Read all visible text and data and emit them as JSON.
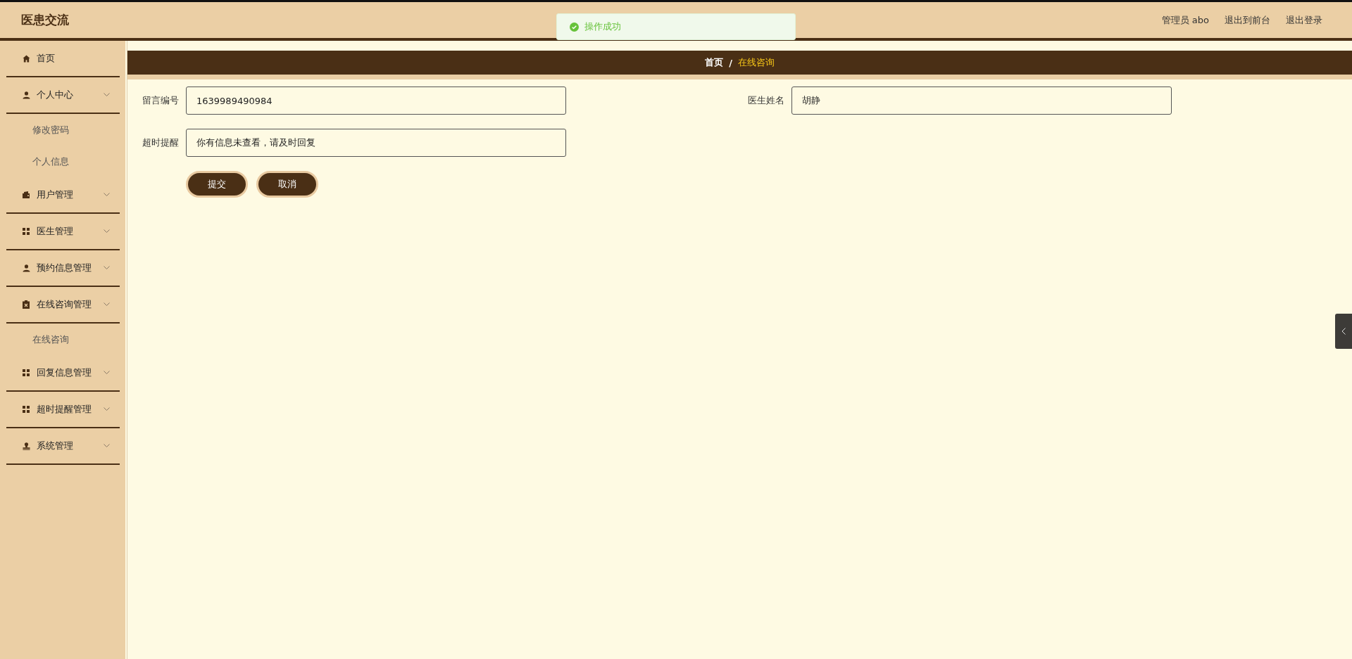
{
  "header": {
    "title": "医患交流",
    "links": [
      {
        "label": "管理员 abo"
      },
      {
        "label": "退出到前台"
      },
      {
        "label": "退出登录"
      }
    ]
  },
  "toast": {
    "kind": "success",
    "message": "操作成功"
  },
  "sidebar": {
    "items": [
      {
        "label": "首页",
        "kind": "link"
      },
      {
        "label": "个人中心",
        "kind": "menu",
        "children": [
          {
            "label": "修改密码"
          },
          {
            "label": "个人信息"
          }
        ]
      },
      {
        "label": "用户管理",
        "kind": "menu"
      },
      {
        "label": "医生管理",
        "kind": "menu"
      },
      {
        "label": "预约信息管理",
        "kind": "menu"
      },
      {
        "label": "在线咨询管理",
        "kind": "menu",
        "children": [
          {
            "label": "在线咨询"
          }
        ]
      },
      {
        "label": "回复信息管理",
        "kind": "menu"
      },
      {
        "label": "超时提醒管理",
        "kind": "menu"
      },
      {
        "label": "系统管理",
        "kind": "menu"
      }
    ]
  },
  "breadcrumb": [
    {
      "label": "首页",
      "selected": false
    },
    {
      "label": "在线咨询",
      "selected": true
    }
  ],
  "breadcrumb_separator": "/",
  "form": {
    "fields": [
      {
        "label": "留言编号",
        "value": "1639989490984"
      },
      {
        "label": "医生姓名",
        "value": "胡静"
      },
      {
        "label": "超时提醒",
        "value": "你有信息未查看，请及时回复"
      }
    ],
    "buttons": [
      {
        "label": "提交"
      },
      {
        "label": "取消"
      }
    ]
  }
}
